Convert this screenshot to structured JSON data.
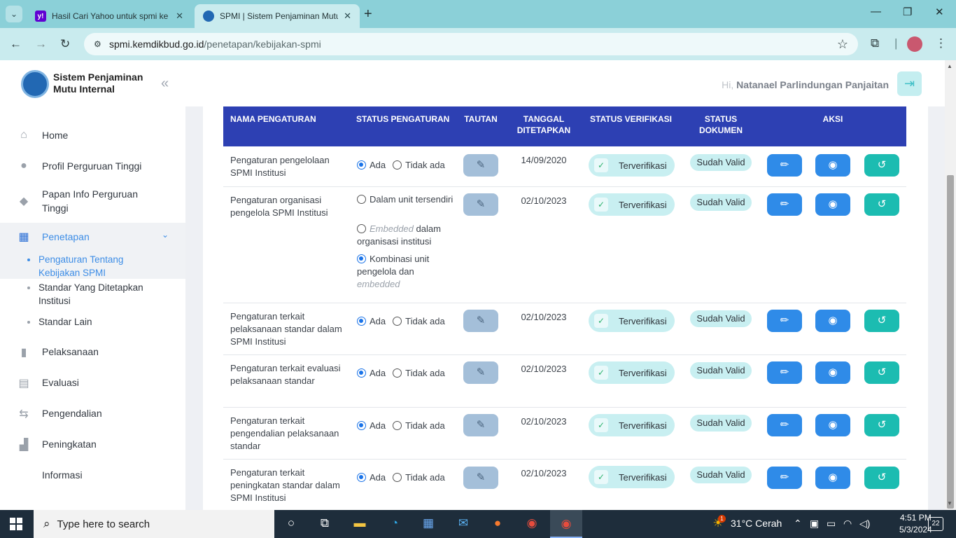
{
  "browser": {
    "tabs": [
      {
        "title": "Hasil Cari Yahoo untuk spmi ke",
        "active": false
      },
      {
        "title": "SPMI | Sistem Penjaminan Mutu",
        "active": true
      }
    ],
    "url_domain": "spmi.kemdikbud.go.id",
    "url_path": "/penetapan/kebijakan-spmi"
  },
  "sidebar": {
    "brand": "Sistem Penjaminan Mutu Internal",
    "menu": [
      {
        "label": "Home",
        "icon": "home-icon"
      },
      {
        "label": "Profil Perguruan Tinggi",
        "icon": "user-icon"
      },
      {
        "label": "Papan Info Perguruan Tinggi",
        "icon": "diamond-icon"
      },
      {
        "label": "Penetapan",
        "icon": "building-icon",
        "active": true
      },
      {
        "label": "Pelaksanaan",
        "icon": "book-icon"
      },
      {
        "label": "Evaluasi",
        "icon": "clipboard-icon"
      },
      {
        "label": "Pengendalian",
        "icon": "repeat-icon"
      },
      {
        "label": "Peningkatan",
        "icon": "stairs-icon"
      },
      {
        "label": "Informasi",
        "icon": ""
      }
    ],
    "submenu": [
      {
        "label": "Pengaturan Tentang Kebijakan SPMI",
        "active": true
      },
      {
        "label": "Standar Yang Ditetapkan Institusi",
        "active": false
      },
      {
        "label": "Standar Lain",
        "active": false
      }
    ]
  },
  "header": {
    "greeting_prefix": "Hi,",
    "user_name": "Natanael Parlindungan Panjaitan"
  },
  "table": {
    "columns": [
      "NAMA PENGATURAN",
      "STATUS PENGATURAN",
      "TAUTAN",
      "TANGGAL DITETAPKAN",
      "STATUS VERIFIKASI",
      "STATUS DOKUMEN",
      "AKSI"
    ],
    "opt_ada": "Ada",
    "opt_tidak": "Tidak ada",
    "rows": [
      {
        "name": "Pengaturan pengelolaan SPMI Institusi",
        "date": "14/09/2020",
        "verif": "Terverifikasi",
        "dokumen": "Sudah Valid",
        "status": "Ada"
      },
      {
        "name": "Pengaturan organisasi pengelola SPMI Institusi",
        "date": "02/10/2023",
        "verif": "Terverifikasi",
        "dokumen": "Sudah Valid",
        "options": {
          "o1": "Dalam unit tersendiri",
          "o2_em": "Embedded",
          "o2_rest": " dalam organisasi institusi",
          "o3": "Kombinasi unit pengelola dan",
          "o3_em": "embedded"
        },
        "selected": 3
      },
      {
        "name": "Pengaturan terkait pelaksanaan standar dalam SPMI Institusi",
        "date": "02/10/2023",
        "verif": "Terverifikasi",
        "dokumen": "Sudah Valid",
        "status": "Ada"
      },
      {
        "name": "Pengaturan terkait evaluasi pelaksanaan standar",
        "date": "02/10/2023",
        "verif": "Terverifikasi",
        "dokumen": "Sudah Valid",
        "status": "Ada"
      },
      {
        "name": "Pengaturan terkait pengendalian pelaksanaan standar",
        "date": "02/10/2023",
        "verif": "Terverifikasi",
        "dokumen": "Sudah Valid",
        "status": "Ada"
      },
      {
        "name": "Pengaturan terkait peningkatan standar dalam SPMI Institusi",
        "date": "02/10/2023",
        "verif": "Terverifikasi",
        "dokumen": "Sudah Valid",
        "status": "Ada"
      }
    ]
  },
  "taskbar": {
    "search_placeholder": "Type here to search",
    "weather": "31°C  Cerah",
    "time": "4:51 PM",
    "date": "5/3/2024",
    "notifications": "22",
    "weather_badge": "1"
  }
}
